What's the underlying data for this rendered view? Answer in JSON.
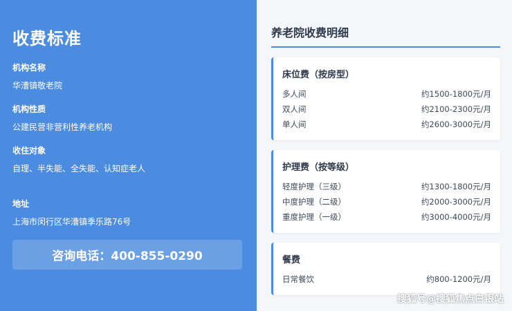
{
  "left": {
    "title": "收费标准",
    "info": [
      {
        "label": "机构名称",
        "value": "华漕镇敬老院"
      },
      {
        "label": "机构性质",
        "value": "公建民营非营利性养老机构"
      },
      {
        "label": "收住对象",
        "value": "自理、半失能、全失能、认知症老人"
      },
      {
        "label": "地址",
        "value": "上海市闵行区华漕镇季乐路76号"
      }
    ],
    "phone": "咨询电话：400-855-0290"
  },
  "right": {
    "title": "养老院收费明细",
    "cards": [
      {
        "title": "床位费（按房型）",
        "rows": [
          {
            "label": "多人间",
            "price": "约1500-1800元/月"
          },
          {
            "label": "双人间",
            "price": "约2100-2300元/月"
          },
          {
            "label": "单人间",
            "price": "约2600-3000元/月"
          }
        ]
      },
      {
        "title": "护理费（按等级）",
        "rows": [
          {
            "label": "轻度护理（三级）",
            "price": "约1300-1800元/月"
          },
          {
            "label": "中度护理（二级）",
            "price": "约2000-3000元/月"
          },
          {
            "label": "重度护理（一级）",
            "price": "约3000-4000元/月"
          }
        ]
      },
      {
        "title": "餐费",
        "rows": [
          {
            "label": "日常餐饮",
            "price": "约800-1200元/月"
          }
        ]
      }
    ]
  },
  "watermark": "搜狐号@搜狐焦点白银站",
  "colors": {
    "accent": "#4b8be0",
    "text_dark": "#2e3a4c"
  }
}
